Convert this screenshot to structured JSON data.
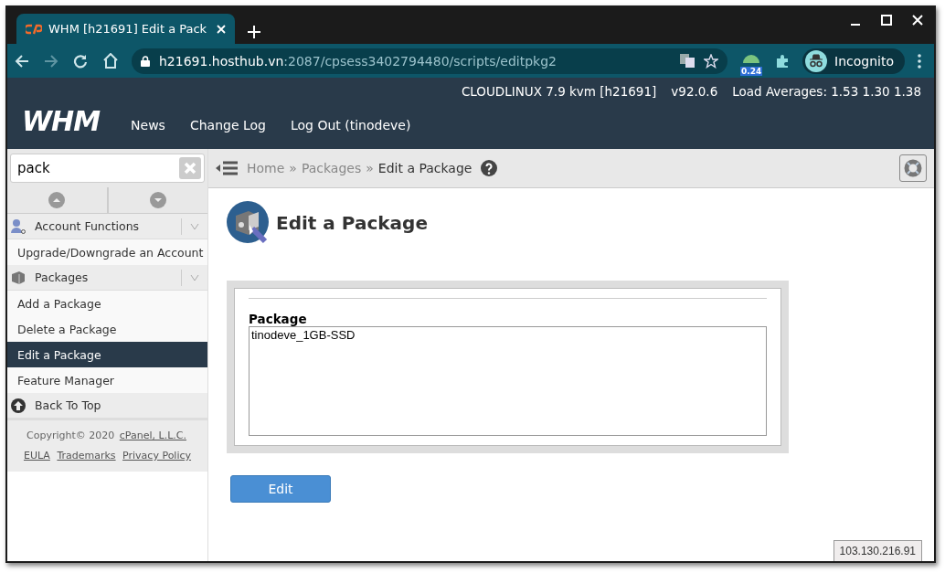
{
  "browser": {
    "tab_title": "WHM [h21691] Edit a Pack",
    "url_host": "h21691.hosthub.vn",
    "url_path": ":2087/cpsess3402794480/scripts/editpkg2",
    "extension_badge": "0.24",
    "profile_label": "Incognito"
  },
  "header": {
    "server_info": [
      "CLOUDLINUX 7.9 kvm [h21691]",
      "v92.0.6",
      "Load Averages: 1.53 1.30 1.38"
    ],
    "logo": "WHM",
    "nav": [
      "News",
      "Change Log",
      "Log Out (tinodeve)"
    ]
  },
  "sidebar": {
    "search_value": "pack",
    "items": [
      {
        "kind": "category",
        "label": "Account Functions",
        "selected": false
      },
      {
        "kind": "link",
        "label": "Upgrade/Downgrade an Account",
        "selected": false
      },
      {
        "kind": "category",
        "label": "Packages",
        "selected": false
      },
      {
        "kind": "link",
        "label": "Add a Package",
        "selected": false
      },
      {
        "kind": "link",
        "label": "Delete a Package",
        "selected": false
      },
      {
        "kind": "link",
        "label": "Edit a Package",
        "selected": true
      },
      {
        "kind": "link",
        "label": "Feature Manager",
        "selected": false
      },
      {
        "kind": "back",
        "label": "Back To Top",
        "selected": false
      }
    ],
    "copyright": "Copyright© 2020",
    "copyright_link": "cPanel, L.L.C.",
    "footer_links": [
      "EULA",
      "Trademarks",
      "Privacy Policy"
    ]
  },
  "breadcrumb": [
    "Home",
    "Packages",
    "Edit a Package"
  ],
  "breadcrumb_separators": [
    "»",
    "»"
  ],
  "page_title": "Edit a Package",
  "form": {
    "label": "Package",
    "options": [
      {
        "text": "tinodeve_1GB-SSD",
        "selected": false
      }
    ],
    "button": "Edit"
  },
  "ip_address": "103.130.216.91"
}
